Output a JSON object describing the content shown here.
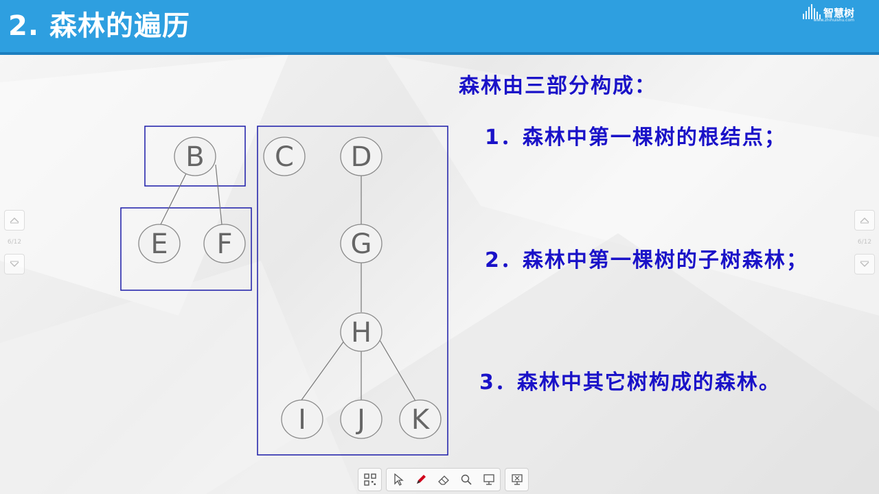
{
  "header": {
    "title": "2. 森林的遍历",
    "logo_text": "智慧树",
    "logo_sub": "www.zhihuishu.com"
  },
  "diagram": {
    "nodes": [
      {
        "id": "B",
        "label": "B"
      },
      {
        "id": "E",
        "label": "E"
      },
      {
        "id": "F",
        "label": "F"
      },
      {
        "id": "C",
        "label": "C"
      },
      {
        "id": "D",
        "label": "D"
      },
      {
        "id": "G",
        "label": "G"
      },
      {
        "id": "H",
        "label": "H"
      },
      {
        "id": "I",
        "label": "I"
      },
      {
        "id": "J",
        "label": "J"
      },
      {
        "id": "K",
        "label": "K"
      }
    ],
    "edges": [
      [
        "B",
        "E"
      ],
      [
        "B",
        "F"
      ],
      [
        "D",
        "G"
      ],
      [
        "G",
        "H"
      ],
      [
        "H",
        "I"
      ],
      [
        "H",
        "J"
      ],
      [
        "H",
        "K"
      ]
    ]
  },
  "content": {
    "heading": "森林由三部分构成：",
    "item1": "1．森林中第一棵树的根结点；",
    "item2": "2．森林中第一棵树的子树森林；",
    "item3": "3．森林中其它树构成的森林。"
  },
  "nav": {
    "left_page": "6/12",
    "right_page": "6/12"
  },
  "toolbar": {
    "icons": [
      "qr-code-icon",
      "pointer-icon",
      "pen-icon",
      "eraser-icon",
      "zoom-icon",
      "screen-icon",
      "exit-presentation-icon"
    ]
  },
  "colors": {
    "header_bg": "#2e9fe0",
    "text_blue": "#1a12c8",
    "box_border": "#1a1aa8",
    "pen_red": "#d0021b"
  }
}
